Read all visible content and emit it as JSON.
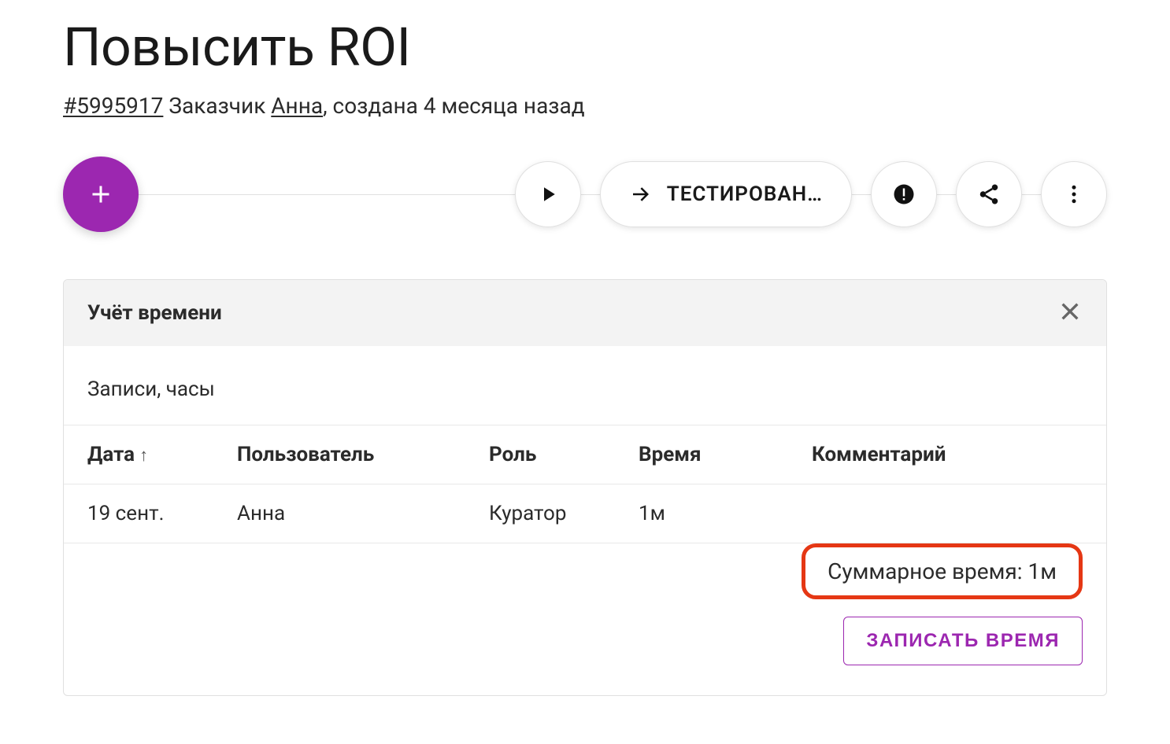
{
  "header": {
    "title": "Повысить ROI",
    "ticket_id": "#5995917",
    "customer_label": "Заказчик",
    "customer_name": "Анна",
    "created_suffix": ", создана 4 месяца назад"
  },
  "toolbar": {
    "status_label": "ТЕСТИРОВАН…"
  },
  "panel": {
    "title": "Учёт времени",
    "section_title": "Записи, часы",
    "columns": {
      "date": "Дата",
      "user": "Пользователь",
      "role": "Роль",
      "time": "Время",
      "comment": "Комментарий"
    },
    "rows": [
      {
        "date": "19 сент.",
        "user": "Анна",
        "role": "Куратор",
        "time": "1м",
        "comment": ""
      }
    ],
    "summary_label": "Суммарное время: ",
    "summary_value": "1м",
    "log_button": "ЗАПИСАТЬ ВРЕМЯ"
  }
}
